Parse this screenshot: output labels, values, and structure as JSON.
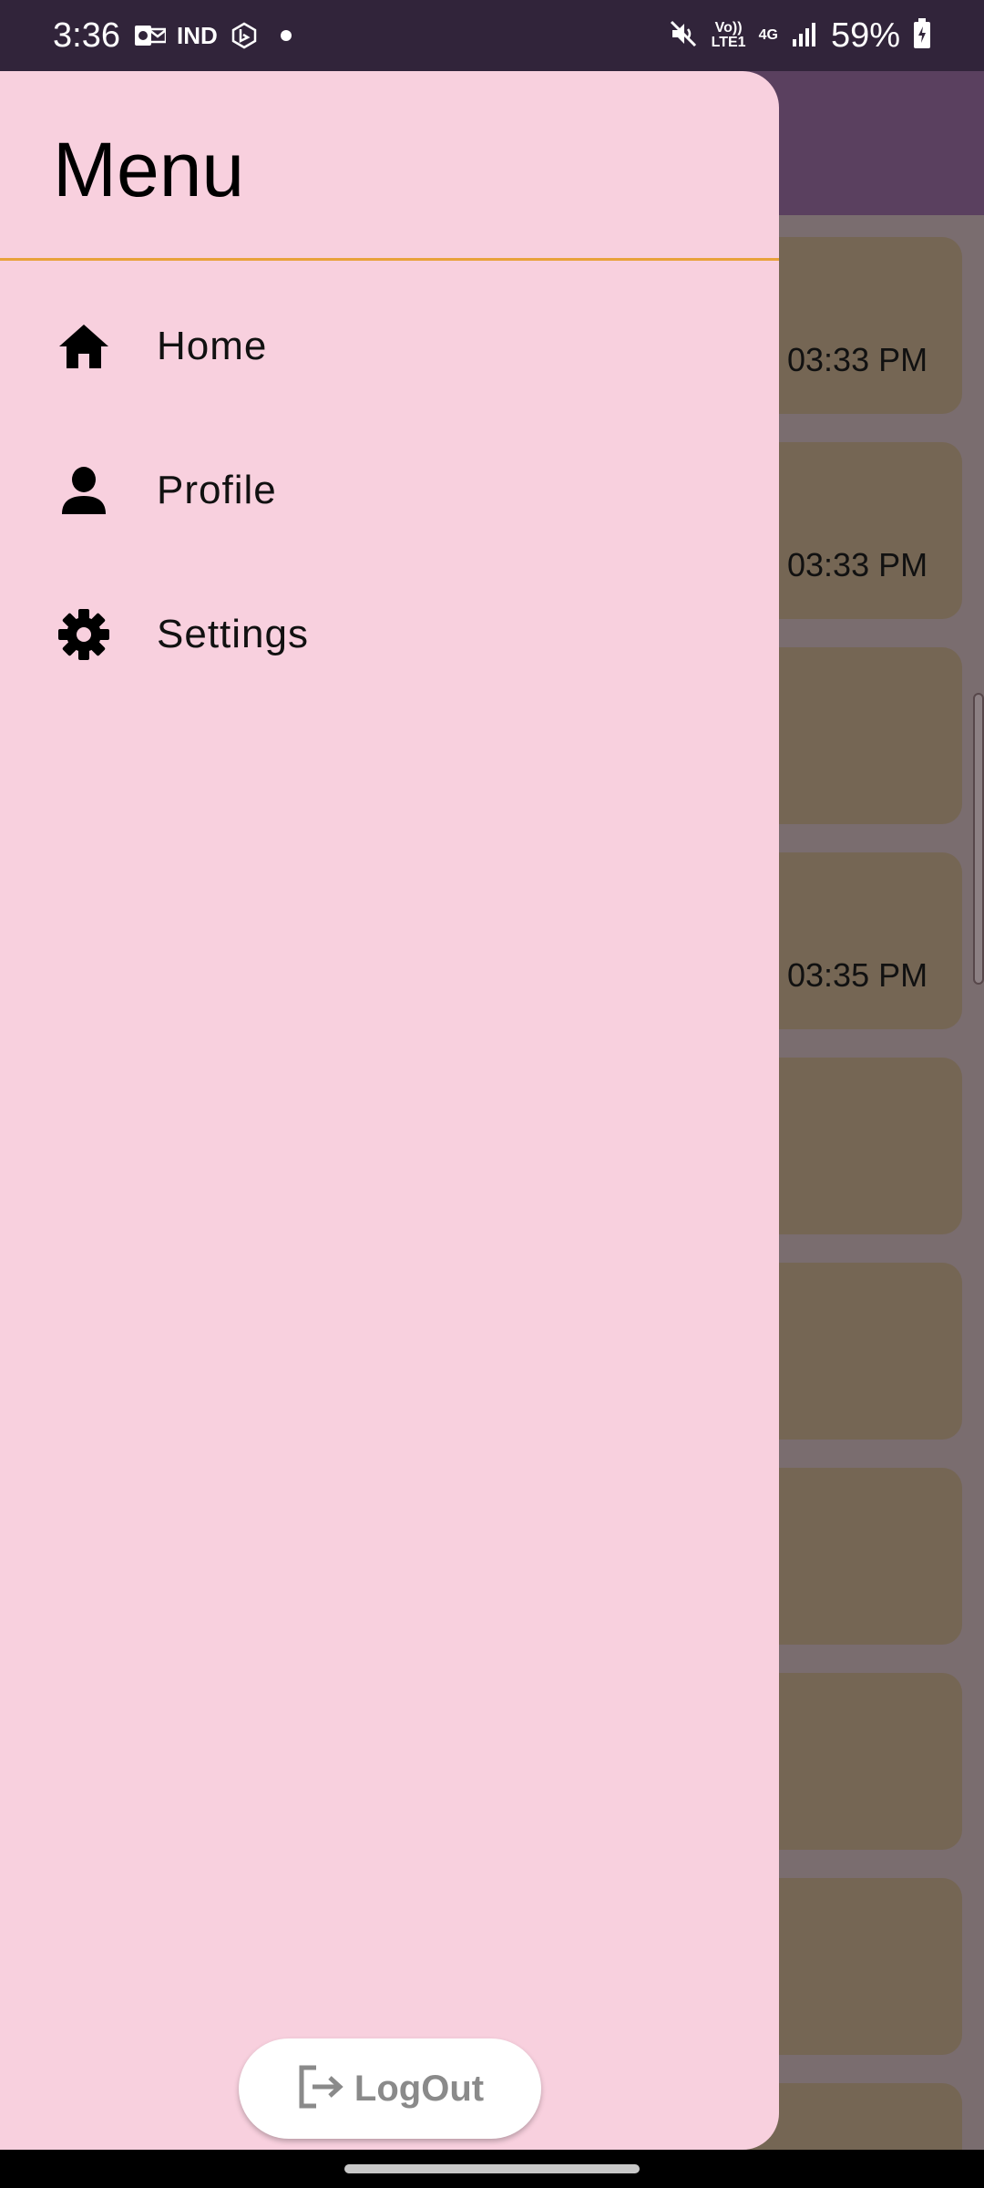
{
  "status_bar": {
    "time": "3:36",
    "left_icons": [
      "outlook-icon",
      "ind-icon",
      "bing-icon",
      "dot-icon"
    ],
    "ind_text": "IND",
    "volte_text": "Vo)) LTE1",
    "network_text": "4G",
    "battery_percent": "59%"
  },
  "drawer": {
    "title": "Menu",
    "items": [
      {
        "label": "Home",
        "icon": "home-icon"
      },
      {
        "label": "Profile",
        "icon": "person-icon"
      },
      {
        "label": "Settings",
        "icon": "gear-icon"
      }
    ],
    "logout_label": "LogOut"
  },
  "background_list": {
    "visible_times": [
      "03:33 PM",
      "03:33 PM",
      "03:35 PM"
    ]
  },
  "colors": {
    "drawer_bg": "#f8d0de",
    "header_divider": "#e8a13a",
    "app_bar": "#5a405f",
    "card": "#756654"
  }
}
